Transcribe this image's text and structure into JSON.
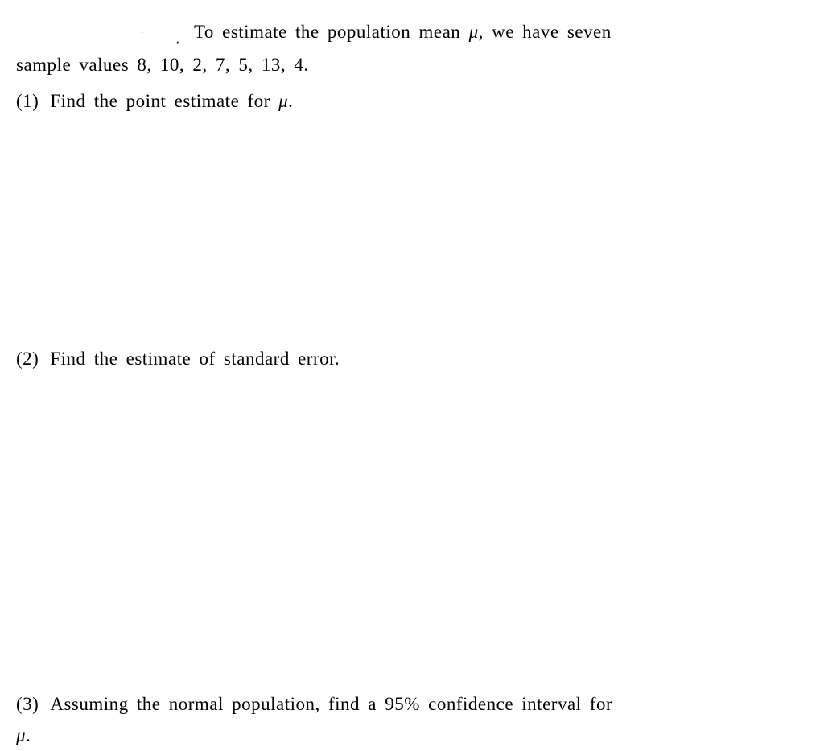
{
  "intro": {
    "prefix_dots": "·",
    "lead_in": "To estimate the population mean",
    "symbol": "μ",
    "after_symbol": ", we have seven",
    "line2": "sample values 8, 10, 2, 7, 5, 13, 4."
  },
  "parts": {
    "p1": {
      "label": "(1)",
      "text_before": "Find the point estimate for ",
      "symbol": "μ",
      "text_after": "."
    },
    "p2": {
      "label": "(2)",
      "text": "Find the estimate of standard error."
    },
    "p3": {
      "label": "(3)",
      "text_before": "Assuming the normal population, find a 95% confidence interval for",
      "symbol": "μ",
      "text_after": "."
    }
  }
}
